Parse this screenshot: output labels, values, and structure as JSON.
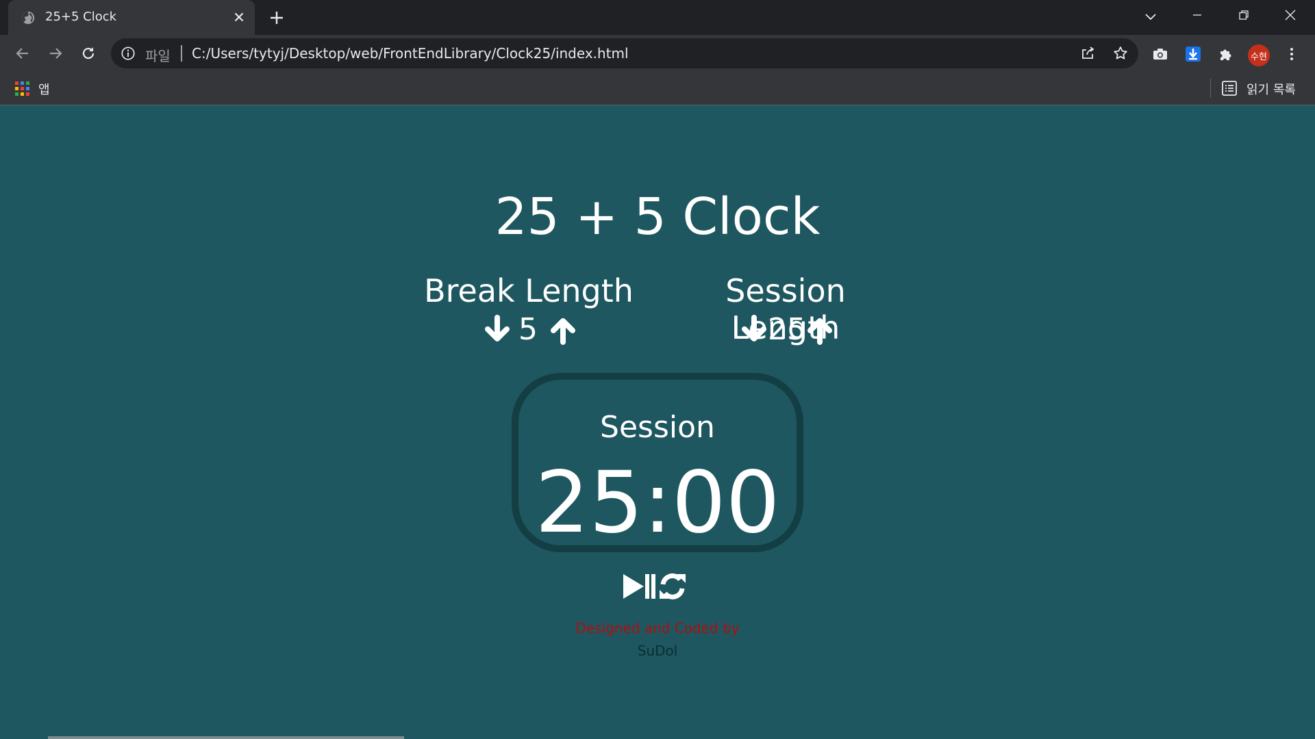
{
  "browser": {
    "tab_title": "25+5 Clock",
    "omnibox": {
      "scheme_label": "파일",
      "url": "C:/Users/tytyj/Desktop/web/FrontEndLibrary/Clock25/index.html"
    },
    "profile_initials": "수현",
    "bookmarks": {
      "apps_label": "앱",
      "reading_list_label": "읽기 목록"
    }
  },
  "app": {
    "title": "25 + 5 Clock",
    "break": {
      "label": "Break Length",
      "value": "5"
    },
    "session": {
      "label": "Session Length",
      "value": "25"
    },
    "timer": {
      "label": "Session",
      "value": "25:00"
    },
    "credit_line1": "Designed and Coded by",
    "credit_line2": "SuDol"
  },
  "colors": {
    "page_background": "#1e5760",
    "timer_border": "#123e44",
    "credit_line1": "#b00f0f",
    "credit_line2": "#0b2d33"
  }
}
